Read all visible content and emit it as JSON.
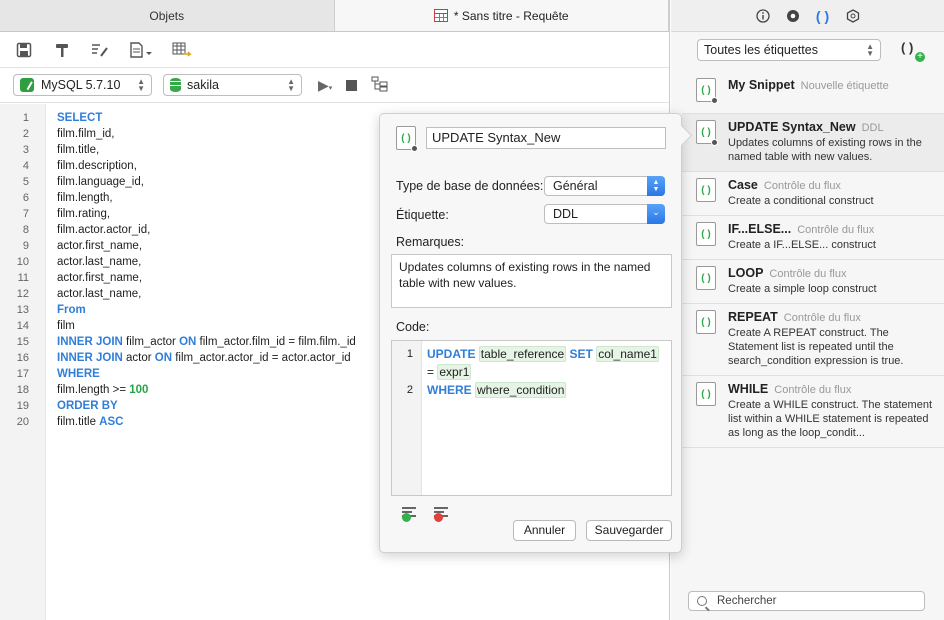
{
  "tabs": {
    "objects": "Objets",
    "query": "* Sans titre - Requête"
  },
  "toolbar": {
    "connection": "MySQL 5.7.10",
    "database": "sakila"
  },
  "editor": {
    "line_numbers": [
      "1",
      "2",
      "3",
      "4",
      "5",
      "6",
      "7",
      "8",
      "9",
      "10",
      "11",
      "12",
      "13",
      "14",
      "15",
      "16",
      "17",
      "18",
      "19",
      "20"
    ]
  },
  "sidebar": {
    "filter": "Toutes les étiquettes",
    "search_placeholder": "Rechercher",
    "snippets": [
      {
        "name": "My Snippet",
        "tag": "Nouvelle étiquette",
        "desc": ""
      },
      {
        "name": "UPDATE Syntax_New",
        "tag": "DDL",
        "desc": "Updates columns of existing rows in the named table with new values."
      },
      {
        "name": "Case",
        "tag": "Contrôle du flux",
        "desc": "Create a conditional construct"
      },
      {
        "name": "IF...ELSE...",
        "tag": "Contrôle du flux",
        "desc": "Create a IF...ELSE... construct"
      },
      {
        "name": "LOOP",
        "tag": "Contrôle du flux",
        "desc": "Create a simple loop construct"
      },
      {
        "name": "REPEAT",
        "tag": "Contrôle du flux",
        "desc": "Create A REPEAT construct. The Statement list is repeated until the search_condition expression is true."
      },
      {
        "name": "WHILE",
        "tag": "Contrôle du flux",
        "desc": "Create a WHILE construct. The statement list within a WHILE statement is repeated as long as the loop_condit..."
      }
    ]
  },
  "popover": {
    "name": "UPDATE Syntax_New",
    "db_type_label": "Type de base de données:",
    "db_type_value": "Général",
    "tag_label": "Étiquette:",
    "tag_value": "DDL",
    "remarks_label": "Remarques:",
    "remarks": "Updates columns of existing rows in the named table with new values.",
    "code_label": "Code:",
    "cancel": "Annuler",
    "save": "Sauvegarder"
  },
  "colors": {
    "keyword": "#2f7fd9",
    "number": "#27a44a",
    "accent": "#2a77e6"
  }
}
